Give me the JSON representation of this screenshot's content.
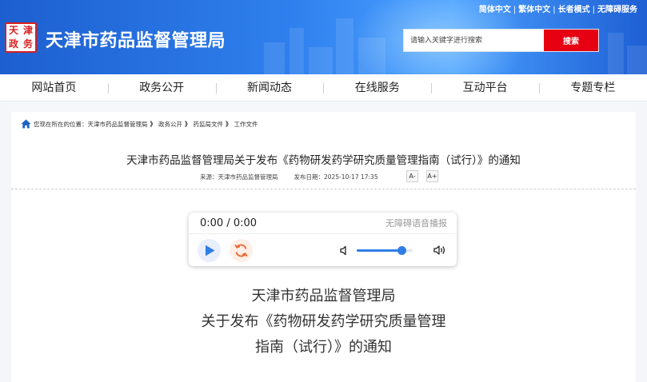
{
  "header": {
    "logo_chars": [
      "天",
      "津",
      "政",
      "务"
    ],
    "site_title": "天津市药品监督管理局",
    "toplinks": [
      "简体中文",
      "繁体中文",
      "长者模式",
      "无障碍服务"
    ],
    "search": {
      "placeholder": "请输入关键字进行搜索",
      "button_label": "搜索"
    }
  },
  "nav": {
    "items": [
      "网站首页",
      "政务公开",
      "新闻动态",
      "在线服务",
      "互动平台",
      "专题专栏"
    ]
  },
  "breadcrumb": {
    "prefix": "您现在所在的位置：",
    "items": [
      "天津市药品监督管理局",
      "政务公开",
      "药监局文件",
      "工作文件"
    ],
    "separator": "》"
  },
  "article": {
    "title": "天津市药品监督管理局关于发布《药物研发药学研究质量管理指南（试行）》的通知",
    "source_label": "来源：",
    "source": "天津市药品监督管理局",
    "date_label": "发布日期：",
    "date": "2025-10-17 17:35",
    "font_decrease": "A-",
    "font_increase": "A+"
  },
  "player": {
    "time": "0:00 / 0:00",
    "label": "无障碍语音播报",
    "volume": 0.8
  },
  "doc_heading": {
    "lines": [
      "天津市药品监督管理局",
      "关于发布《药物研发药学研究质量管理",
      "指南（试行）》的通知"
    ]
  },
  "colors": {
    "header_blue": "#2f80ee",
    "search_red": "#e60012",
    "player_accent": "#2f7ee6",
    "repeat_accent": "#f0652f"
  }
}
